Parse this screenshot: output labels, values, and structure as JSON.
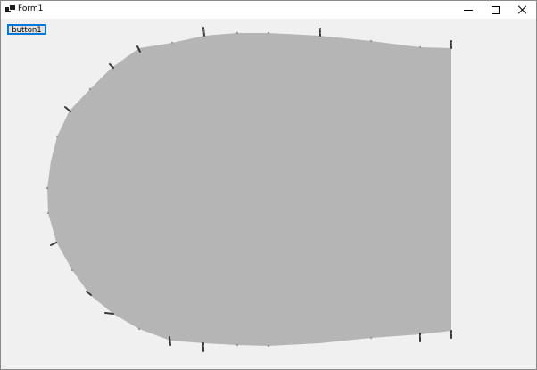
{
  "window": {
    "title": "Form1",
    "controls": {
      "minimize_icon": "minimize-icon",
      "maximize_icon": "maximize-icon",
      "close_icon": "close-icon"
    }
  },
  "content": {
    "button_label": "button1"
  },
  "colors": {
    "shape_fill": "#b5b5b5",
    "background": "#f0f0f0",
    "button_border": "#0078d7"
  }
}
